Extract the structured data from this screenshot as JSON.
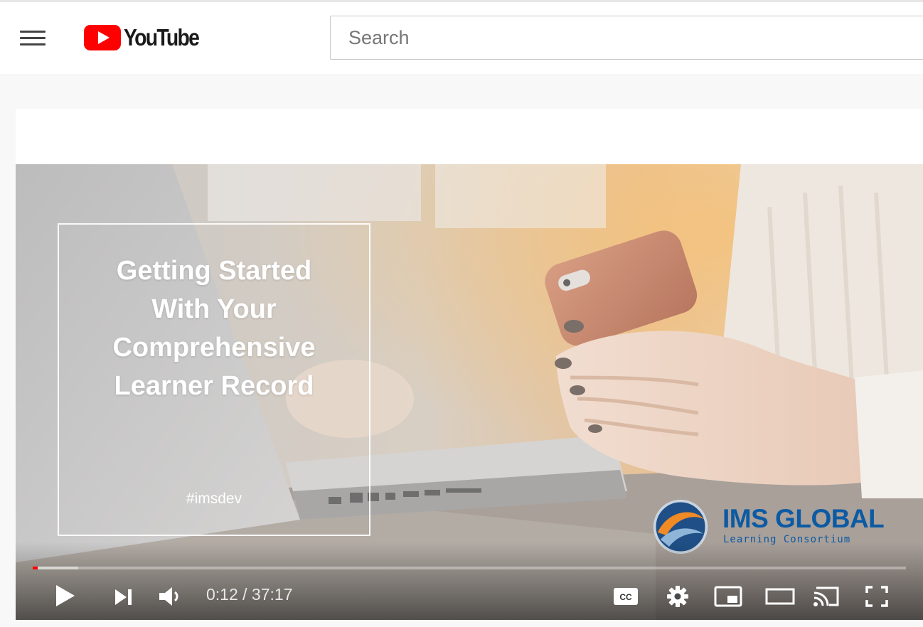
{
  "header": {
    "logo_text": "YouTube",
    "search_placeholder": "Search",
    "brand_color": "#ff0000"
  },
  "video": {
    "thumbnail_title_lines": [
      "Getting Started",
      "With Your",
      "Comprehensive",
      "Learner Record"
    ],
    "hashtag": "#imsdev",
    "sponsor": {
      "name": "IMS GLOBAL",
      "tagline": "Learning Consortium",
      "color": "#0c5aa3"
    }
  },
  "player": {
    "current_time": "0:12",
    "duration": "37:17",
    "time_display": "0:12 / 37:17",
    "progress_fraction": 0.0054,
    "buffered_fraction": 0.052,
    "icons": [
      "play-icon",
      "next-icon",
      "volume-icon",
      "captions-icon",
      "settings-icon",
      "miniplayer-icon",
      "theater-icon",
      "cast-icon",
      "fullscreen-icon"
    ]
  }
}
